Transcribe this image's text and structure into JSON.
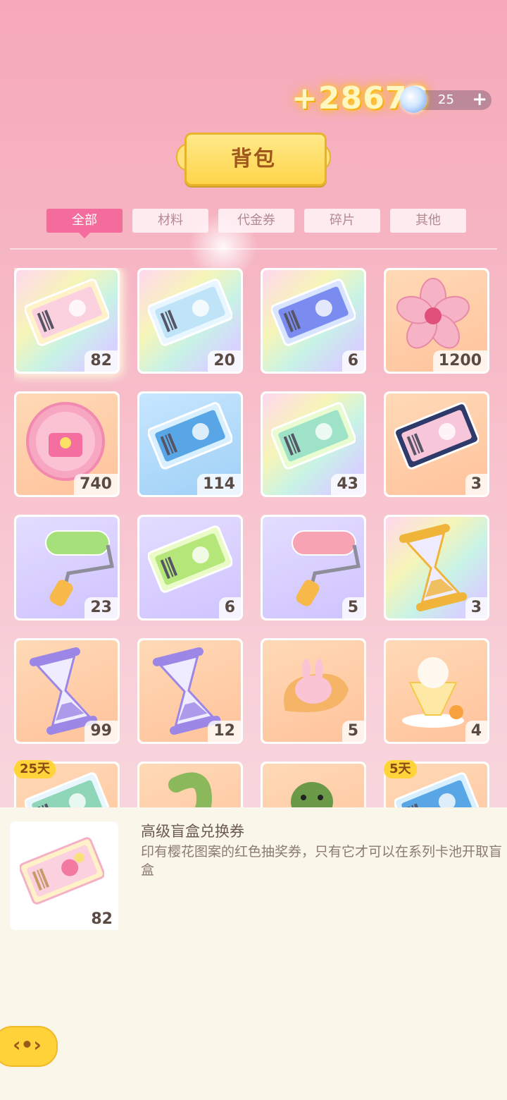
{
  "header": {
    "gold_gain": "+28673",
    "gem_count": "25",
    "gem_plus": "+",
    "title": "背包"
  },
  "tabs": [
    {
      "label": "全部",
      "active": true
    },
    {
      "label": "材料",
      "active": false
    },
    {
      "label": "代金券",
      "active": false
    },
    {
      "label": "碎片",
      "active": false
    },
    {
      "label": "其他",
      "active": false
    }
  ],
  "items": [
    {
      "count": "82",
      "bg": "rainbow",
      "icon": "sakura-ticket-icon",
      "selected": true
    },
    {
      "count": "20",
      "bg": "rainbow",
      "icon": "character-ticket-icon"
    },
    {
      "count": "6",
      "bg": "rainbow",
      "icon": "mystery-ticket-icon"
    },
    {
      "count": "1200",
      "bg": "peach",
      "icon": "sakura-flower-icon"
    },
    {
      "count": "740",
      "bg": "peach",
      "icon": "pink-box-coin-icon"
    },
    {
      "count": "114",
      "bg": "blue",
      "icon": "blue-ticket-icon"
    },
    {
      "count": "43",
      "bg": "rainbow",
      "icon": "video-ticket-icon"
    },
    {
      "count": "3",
      "bg": "peach",
      "icon": "navy-box-ticket-icon"
    },
    {
      "count": "23",
      "bg": "lilac",
      "icon": "green-paint-roller-icon"
    },
    {
      "count": "6",
      "bg": "lilac",
      "icon": "green-box-ticket-icon"
    },
    {
      "count": "5",
      "bg": "lilac",
      "icon": "pink-paint-roller-icon"
    },
    {
      "count": "3",
      "bg": "rainbow",
      "icon": "golden-hourglass-icon"
    },
    {
      "count": "99",
      "bg": "peach",
      "icon": "purple-hourglass-icon"
    },
    {
      "count": "12",
      "bg": "peach",
      "icon": "purple-hourglass-icon"
    },
    {
      "count": "5",
      "bg": "peach",
      "icon": "bunny-candy-icon"
    },
    {
      "count": "4",
      "bg": "peach",
      "icon": "mango-parfait-icon"
    },
    {
      "count": "",
      "bg": "peach",
      "icon": "green-ticket-icon",
      "badge": "25天"
    },
    {
      "count": "",
      "bg": "peach",
      "icon": "green-scarf-icon"
    },
    {
      "count": "",
      "bg": "peach",
      "icon": "dino-plush-icon"
    },
    {
      "count": "",
      "bg": "peach",
      "icon": "blue-ticket-icon",
      "badge": "5天"
    }
  ],
  "detail": {
    "title": "高级盲盒兑换券",
    "description": "印有樱花图案的红色抽奖券，只有它才可以在系列卡池开取盲盒",
    "count": "82"
  },
  "colors": {
    "tab_active": "#f36c9b",
    "gold": "#ffd54a",
    "panel_bg": "#fbf6ea"
  }
}
